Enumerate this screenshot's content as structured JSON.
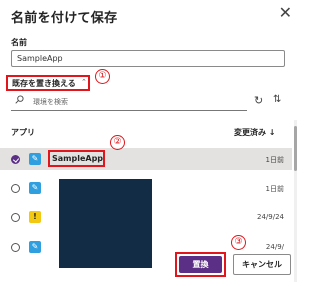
{
  "dialog": {
    "title": "名前を付けて保存"
  },
  "name_field": {
    "label": "名前",
    "value": "SampleApp"
  },
  "replace_link": {
    "label": "既存を置き換える"
  },
  "search": {
    "placeholder": "環境を検索"
  },
  "columns": {
    "app": "アプリ",
    "modified": "変更済み ↓"
  },
  "rows": [
    {
      "name": "SampleApp",
      "date": "1日前",
      "icon": "pen-icon",
      "icon_color": "#2f9fe0",
      "selected": true
    },
    {
      "name": "",
      "date": "1日前",
      "icon": "pen-icon",
      "icon_color": "#2f9fe0",
      "selected": false
    },
    {
      "name": "",
      "date": "24/9/24",
      "icon": "exclamation-icon",
      "icon_color": "#f2c811",
      "selected": false
    },
    {
      "name": "",
      "date": "24/9/",
      "icon": "pen-icon",
      "icon_color": "#2f9fe0",
      "selected": false
    }
  ],
  "buttons": {
    "save": "置換",
    "cancel": "キャンセル"
  },
  "callouts": [
    "①",
    "②",
    "③"
  ],
  "colors": {
    "primary": "#5b2f86",
    "annotation": "#e0161c",
    "redaction": "#132c45"
  }
}
